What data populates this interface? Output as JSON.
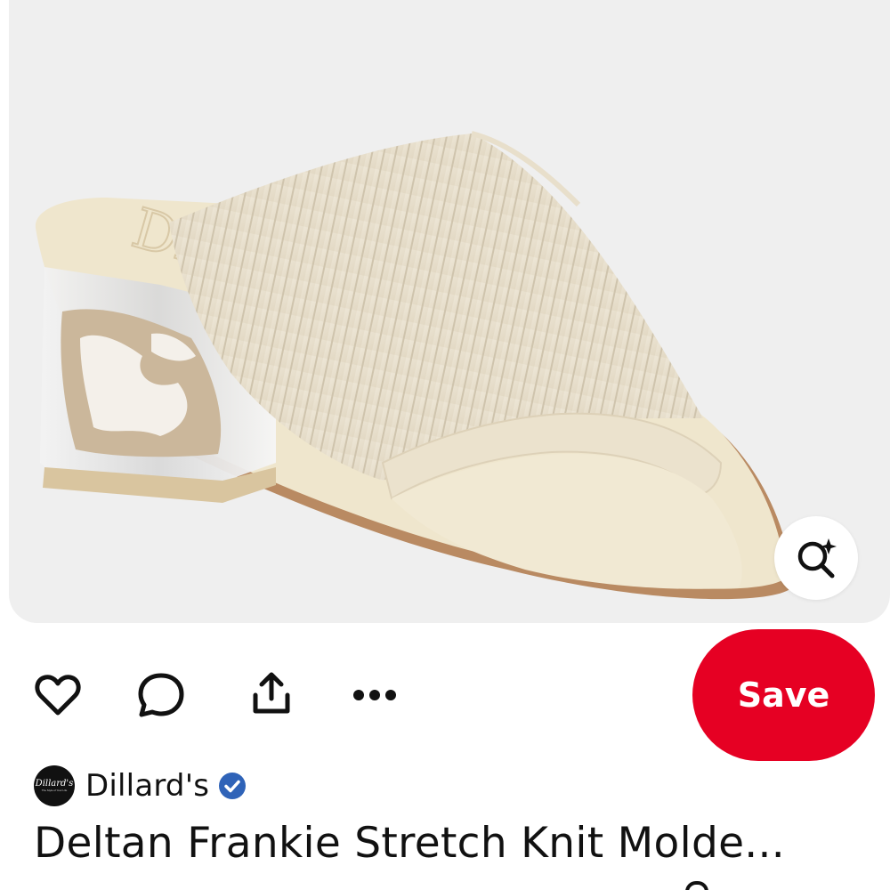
{
  "pin": {
    "image_alt": "Cream stretch knit slide sandal with clear block heel",
    "heel_logo_text": "DELTAN"
  },
  "actions": {
    "heart_icon": "heart-outline-icon",
    "comment_icon": "comment-bubble-icon",
    "share_icon": "share-upload-icon",
    "more_icon": "more-horizontal-icon",
    "lens_icon": "visual-search-sparkle-icon",
    "save_label": "Save"
  },
  "creator": {
    "avatar_logo": "Dillard's",
    "avatar_tagline": "The Style of Your Life",
    "name": "Dillard's",
    "verified_icon": "verified-check-icon"
  },
  "title": "Deltan Frankie Stretch Knit Molde...",
  "colors": {
    "save_bg": "#e60023",
    "verified_bg": "#2f63b8",
    "image_bg": "#efefef",
    "sandal_cream": "#ebe3d2"
  }
}
